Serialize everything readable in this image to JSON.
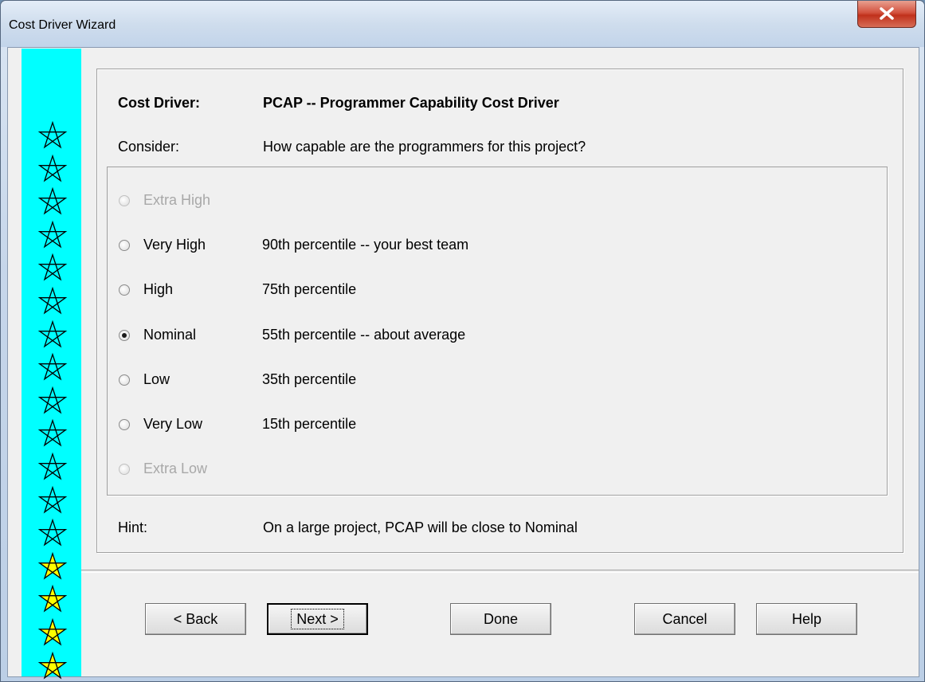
{
  "window": {
    "title": "Cost Driver Wizard"
  },
  "cost_driver": {
    "label": "Cost Driver:",
    "value": "PCAP -- Programmer Capability Cost Driver"
  },
  "consider": {
    "label": "Consider:",
    "value": "How capable are the programmers for this project?"
  },
  "ratings": [
    {
      "label": "Extra High",
      "description": "",
      "enabled": false,
      "selected": false
    },
    {
      "label": "Very High",
      "description": "90th percentile -- your best team",
      "enabled": true,
      "selected": false
    },
    {
      "label": "High",
      "description": "75th percentile",
      "enabled": true,
      "selected": false
    },
    {
      "label": "Nominal",
      "description": "55th percentile -- about average",
      "enabled": true,
      "selected": true
    },
    {
      "label": "Low",
      "description": "35th percentile",
      "enabled": true,
      "selected": false
    },
    {
      "label": "Very Low",
      "description": "15th percentile",
      "enabled": true,
      "selected": false
    },
    {
      "label": "Extra Low",
      "description": "",
      "enabled": false,
      "selected": false
    }
  ],
  "hint": {
    "label": "Hint:",
    "value": "On a large project, PCAP will be close to Nominal"
  },
  "buttons": {
    "back": "< Back",
    "next": "Next >",
    "done": "Done",
    "cancel": "Cancel",
    "help": "Help"
  },
  "progress": {
    "total_steps": 17,
    "completed_steps": 13,
    "completed_color": "#00ffff",
    "pending_color": "#ffff00"
  }
}
